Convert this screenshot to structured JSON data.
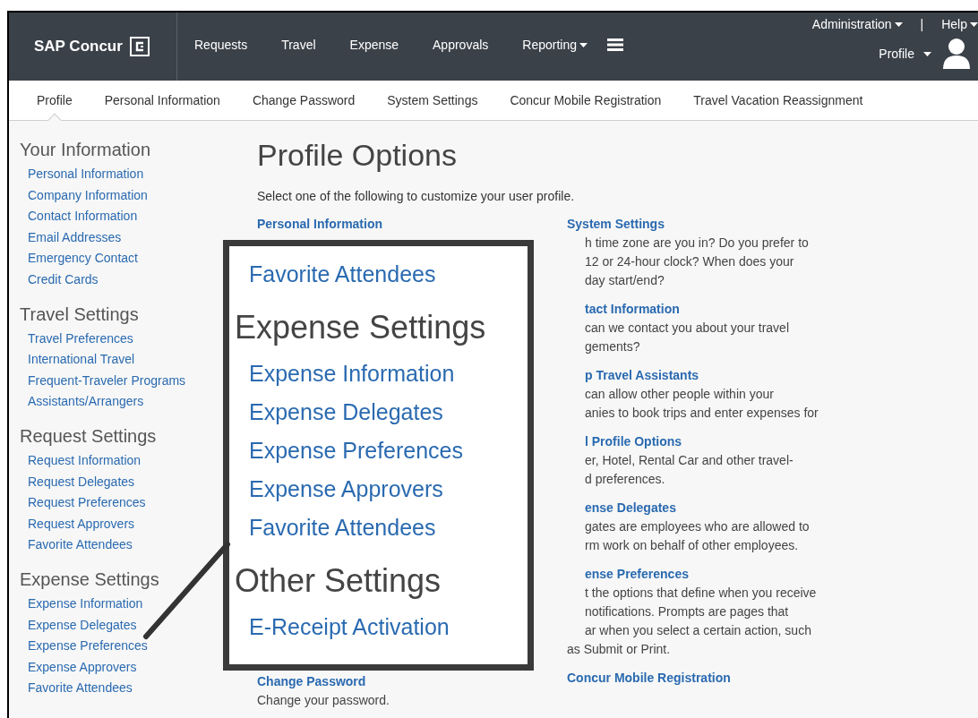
{
  "header": {
    "logo_text": "SAP Concur",
    "nav": [
      {
        "label": "Requests",
        "dropdown": false
      },
      {
        "label": "Travel",
        "dropdown": false
      },
      {
        "label": "Expense",
        "dropdown": false
      },
      {
        "label": "Approvals",
        "dropdown": false
      },
      {
        "label": "Reporting",
        "dropdown": true
      }
    ],
    "utility_links": [
      {
        "label": "Administration",
        "dropdown": true
      },
      {
        "label": "Help",
        "dropdown": true
      }
    ],
    "separator": "|",
    "profile": {
      "label": "Profile"
    }
  },
  "tabs": [
    {
      "label": "Profile",
      "selected": true
    },
    {
      "label": "Personal Information",
      "selected": false
    },
    {
      "label": "Change Password",
      "selected": false
    },
    {
      "label": "System Settings",
      "selected": false
    },
    {
      "label": "Concur Mobile Registration",
      "selected": false
    },
    {
      "label": "Travel Vacation Reassignment",
      "selected": false
    }
  ],
  "sidebar": {
    "sections": [
      {
        "heading": "Your Information",
        "items": [
          "Personal Information",
          "Company Information",
          "Contact Information",
          "Email Addresses",
          "Emergency Contact",
          "Credit Cards"
        ]
      },
      {
        "heading": "Travel Settings",
        "items": [
          "Travel Preferences",
          "International Travel",
          "Frequent-Traveler Programs",
          "Assistants/Arrangers"
        ]
      },
      {
        "heading": "Request Settings",
        "items": [
          "Request Information",
          "Request Delegates",
          "Request Preferences",
          "Request Approvers",
          "Favorite Attendees"
        ]
      },
      {
        "heading": "Expense Settings",
        "items": [
          "Expense Information",
          "Expense Delegates",
          "Expense Preferences",
          "Expense Approvers",
          "Favorite Attendees"
        ]
      }
    ]
  },
  "main": {
    "title": "Profile Options",
    "intro": "Select one of the following to customize your user profile.",
    "left_options": [
      {
        "title": "Personal Information"
      },
      {
        "title": "Change Password",
        "lines": [
          "Change your password."
        ]
      }
    ],
    "right_options": [
      {
        "title": "System Settings",
        "lines": [
          "h time zone are you in? Do you prefer to",
          "12 or 24-hour clock? When does your",
          "day start/end?"
        ]
      },
      {
        "title": "tact Information",
        "lines": [
          "can we contact you about your travel",
          "gements?"
        ]
      },
      {
        "title": "p Travel Assistants",
        "lines": [
          "can allow other people within your",
          "anies to book trips and enter expenses for"
        ]
      },
      {
        "title": "l Profile Options",
        "lines": [
          "er, Hotel, Rental Car and other travel-",
          "d preferences."
        ]
      },
      {
        "title": "ense Delegates",
        "lines": [
          "gates are employees who are allowed to",
          "rm work on behalf of other employees."
        ]
      },
      {
        "title": "ense Preferences",
        "lines": [
          "t the options that define when you receive",
          "notifications. Prompts are pages that",
          "ar when you select a certain action, such"
        ],
        "last_line": "as Submit or Print."
      },
      {
        "title": "Concur Mobile Registration"
      }
    ]
  },
  "callout": {
    "items": [
      {
        "kind": "link",
        "text": "Favorite Attendees"
      },
      {
        "kind": "heading",
        "text": "Expense Settings"
      },
      {
        "kind": "link",
        "text": "Expense Information"
      },
      {
        "kind": "link",
        "text": "Expense Delegates"
      },
      {
        "kind": "link",
        "text": "Expense Preferences"
      },
      {
        "kind": "link",
        "text": "Expense Approvers"
      },
      {
        "kind": "link",
        "text": "Favorite Attendees"
      },
      {
        "kind": "heading",
        "text": "Other Settings"
      },
      {
        "kind": "link",
        "text": "E-Receipt Activation"
      }
    ]
  }
}
